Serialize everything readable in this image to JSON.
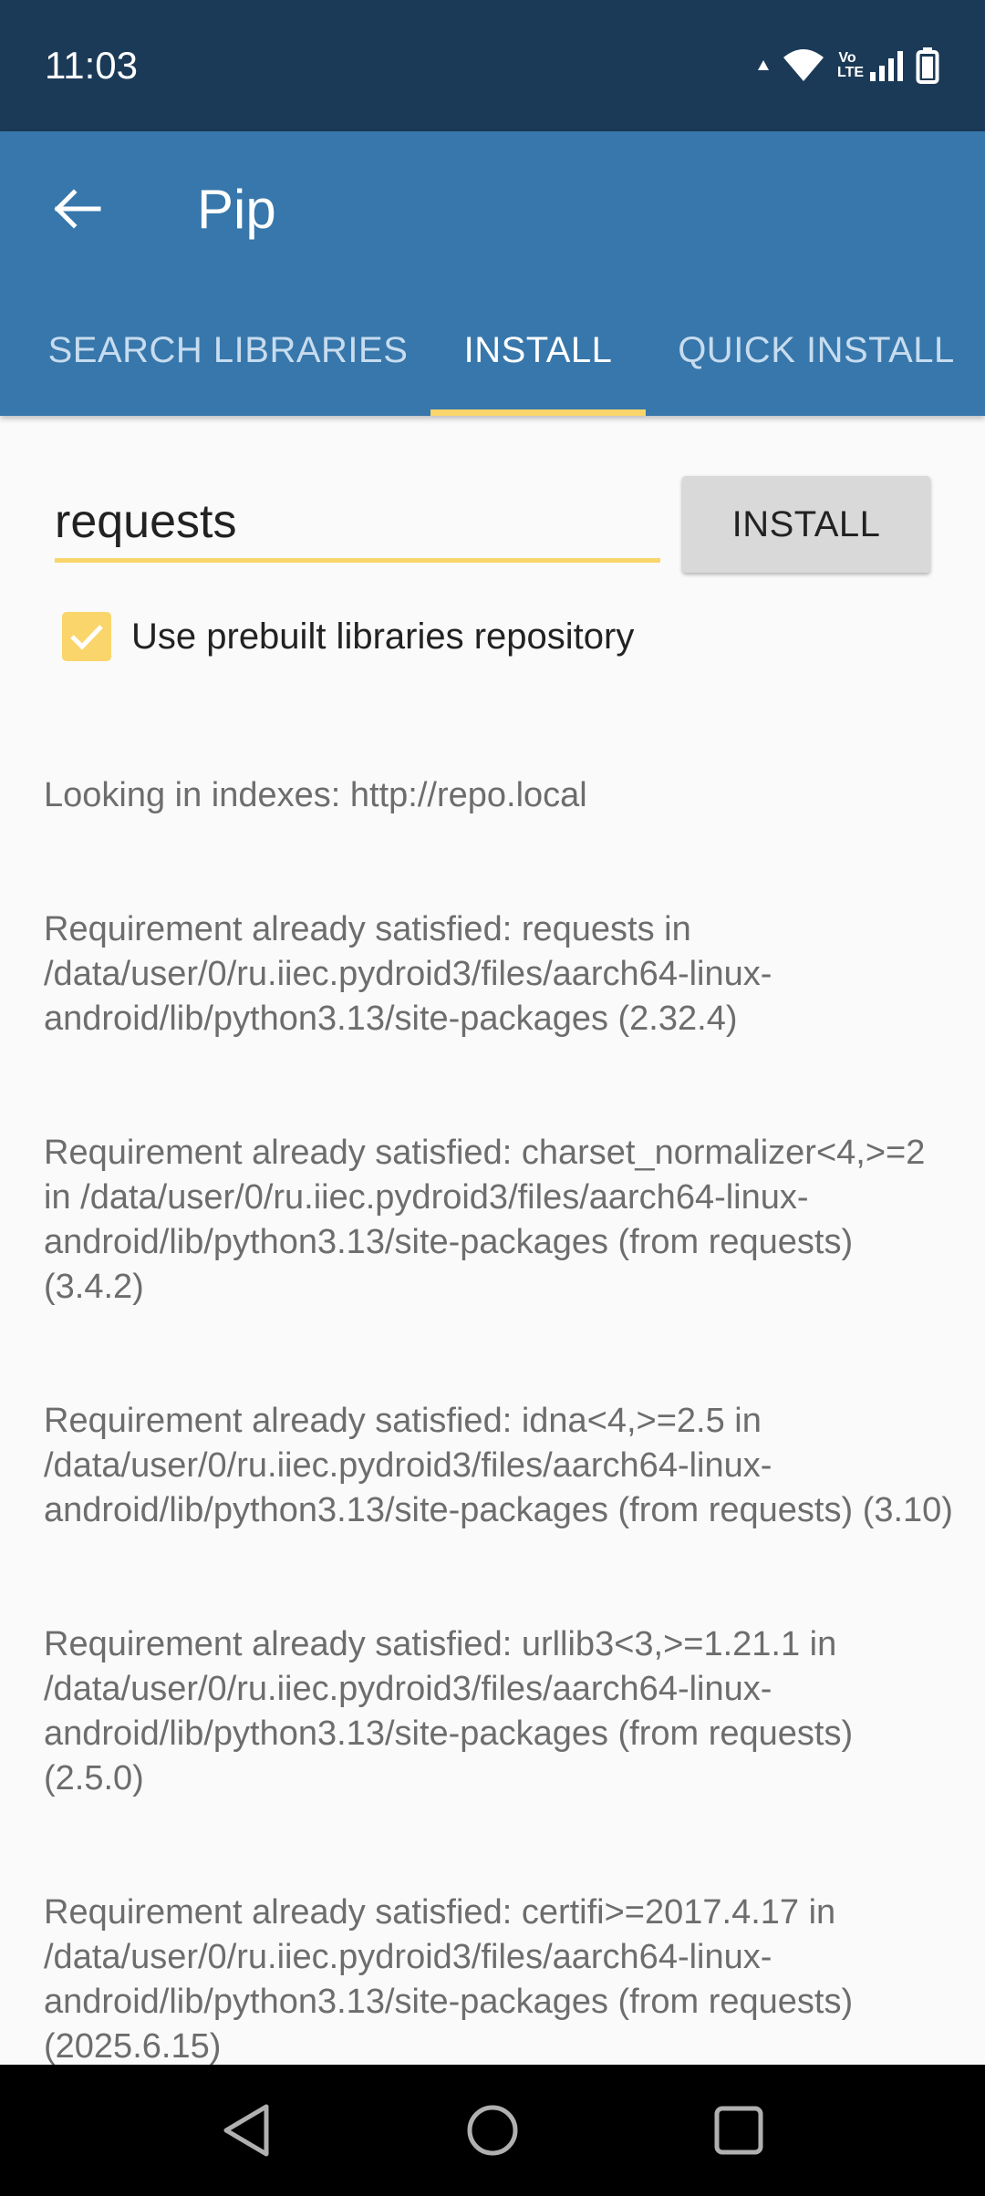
{
  "status_bar": {
    "time": "11:03",
    "icons": [
      "data-arrow-icon",
      "wifi-icon",
      "volte-icon",
      "signal-icon",
      "battery-icon"
    ],
    "volte_label": "Vo LTE"
  },
  "app_bar": {
    "title": "Pip",
    "back_icon": "arrow-left-icon",
    "background_color": "#3777ab"
  },
  "tabs": [
    {
      "label": "SEARCH LIBRARIES",
      "active": false
    },
    {
      "label": "INSTALL",
      "active": true
    },
    {
      "label": "QUICK INSTALL",
      "active": false
    }
  ],
  "install_form": {
    "package_value": "requests",
    "install_button_label": "INSTALL",
    "use_prebuilt_label": "Use prebuilt libraries repository",
    "use_prebuilt_checked": true,
    "accent_color": "#f9d56b"
  },
  "log_lines": [
    "Looking in indexes: http://repo.local",
    "Requirement already satisfied: requests in /data/user/0/ru.iiec.pydroid3/files/aarch64-linux-android/lib/python3.13/site-packages (2.32.4)",
    "Requirement already satisfied: charset_normalizer<4,>=2 in /data/user/0/ru.iiec.pydroid3/files/aarch64-linux-android/lib/python3.13/site-packages (from requests) (3.4.2)",
    "Requirement already satisfied: idna<4,>=2.5 in /data/user/0/ru.iiec.pydroid3/files/aarch64-linux-android/lib/python3.13/site-packages (from requests) (3.10)",
    "Requirement already satisfied: urllib3<3,>=1.21.1 in /data/user/0/ru.iiec.pydroid3/files/aarch64-linux-android/lib/python3.13/site-packages (from requests) (2.5.0)",
    "Requirement already satisfied: certifi>=2017.4.17 in /data/user/0/ru.iiec.pydroid3/files/aarch64-linux-android/lib/python3.13/site-packages (from requests) (2025.6.15)"
  ],
  "nav_bar": {
    "icons": [
      "nav-back-icon",
      "nav-home-icon",
      "nav-recents-icon"
    ]
  }
}
